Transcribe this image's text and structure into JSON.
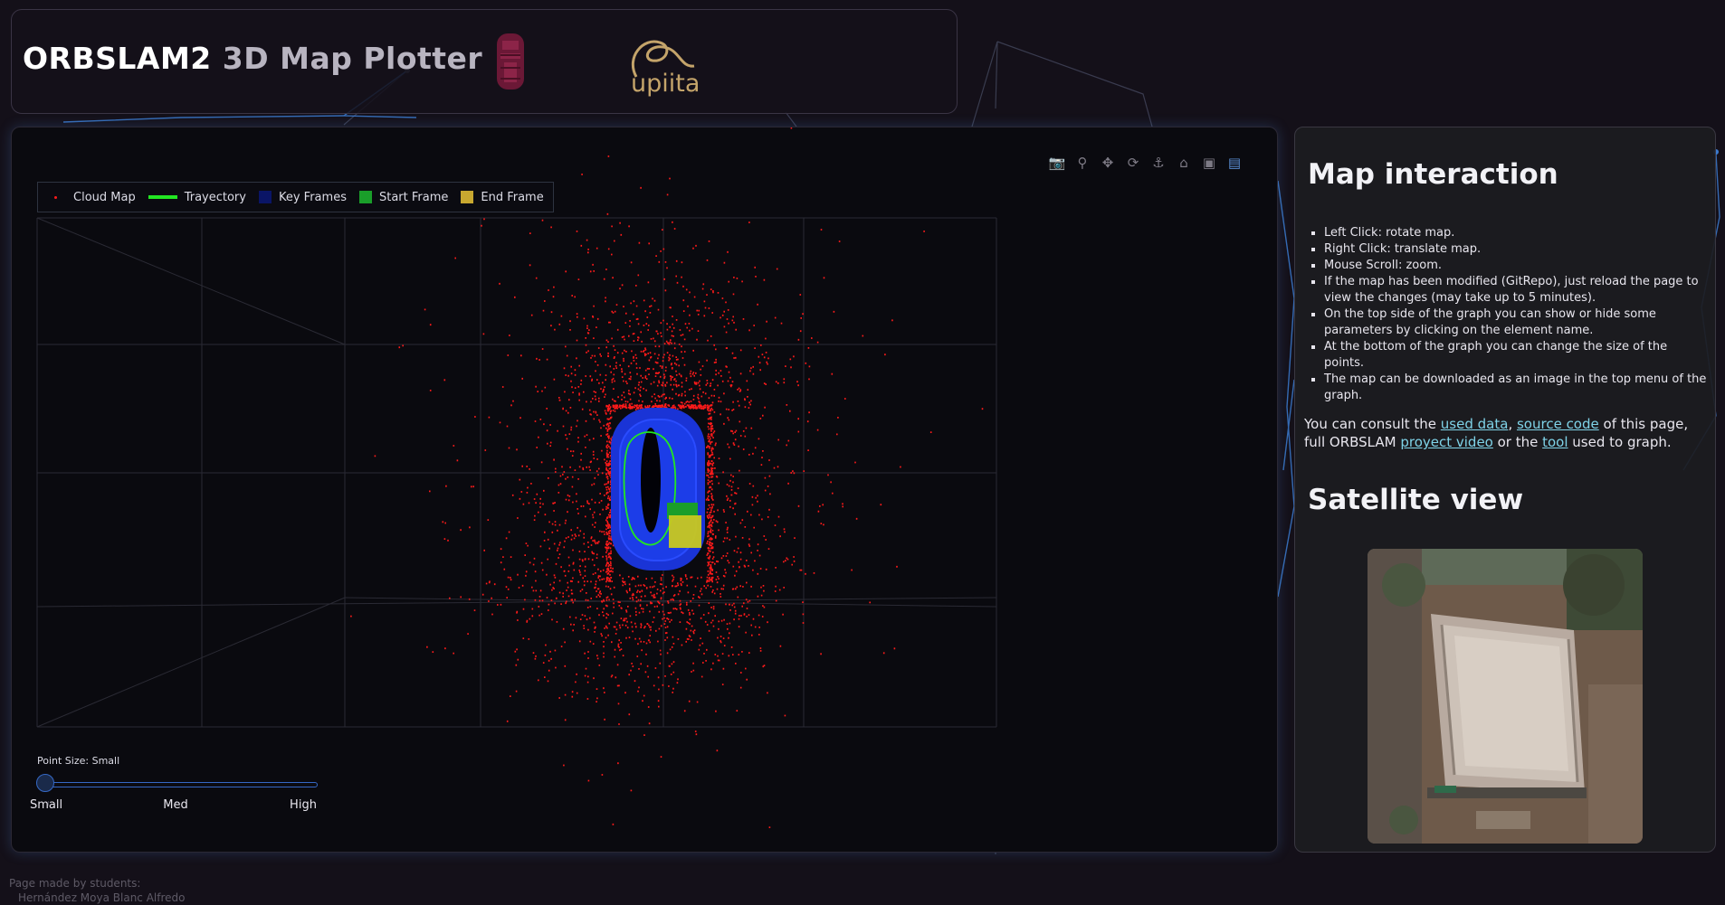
{
  "header": {
    "title_part1": "ORBSLAM2",
    "title_part2": "3D Map Plotter",
    "logo_right_text": "upiita"
  },
  "colors": {
    "cloud_map": "#ff1a1a",
    "trajectory": "#22e622",
    "key_frames": "#0a1566",
    "start_frame": "#1a9e2a",
    "end_frame": "#c8a830",
    "accent": "#3568c4",
    "link": "#7fd3e8"
  },
  "modebar": {
    "icons": [
      "camera-icon",
      "zoom-icon",
      "pan-icon",
      "orbit-icon",
      "turntable-icon",
      "home-icon",
      "video-camera-icon",
      "plotly-logo-icon"
    ]
  },
  "legend": {
    "items": [
      "Cloud Map",
      "Trayectory",
      "Key Frames",
      "Start Frame",
      "End Frame"
    ]
  },
  "slider": {
    "label": "Point Size: Small",
    "ticks": [
      "Small",
      "Med",
      "High"
    ],
    "value_index": 0
  },
  "side": {
    "heading_interaction": "Map interaction",
    "instructions": [
      "Left Click: rotate map.",
      "Right Click: translate map.",
      "Mouse Scroll: zoom.",
      "If the map has been modified (GitRepo), just reload the page to view the changes (may take up to 5 minutes).",
      "On the top side of the graph you can show or hide some parameters by clicking on the element name.",
      "At the bottom of the graph you can change the size of the points.",
      "The map can be downloaded as an image in the top menu of the graph."
    ],
    "consult": {
      "t1": "You can consult the ",
      "link_used_data": "used data",
      "t2": ", ",
      "link_source_code": "source code",
      "t3": " of this page, full ORBSLAM ",
      "link_proyect_video": "proyect video",
      "t4": " or the ",
      "link_tool": "tool",
      "t5": " used to graph."
    },
    "heading_satellite": "Satellite view"
  },
  "footer": {
    "line1": "Page made by students:",
    "line2": "Hernández Moya Blanc Alfredo"
  }
}
